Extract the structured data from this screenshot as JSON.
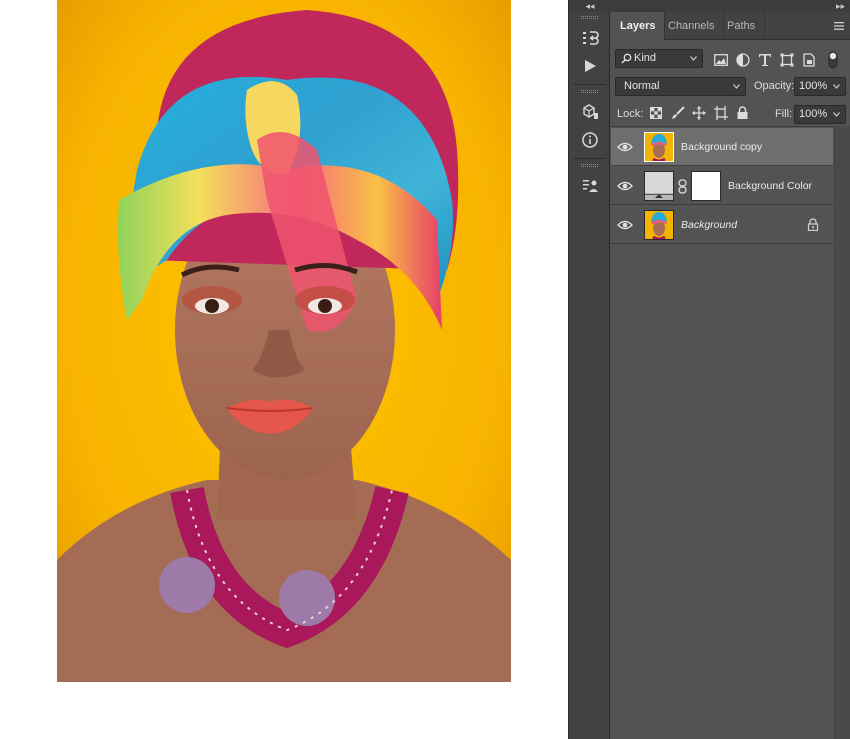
{
  "tabs": [
    {
      "label": "Layers",
      "active": true
    },
    {
      "label": "Channels",
      "active": false
    },
    {
      "label": "Paths",
      "active": false
    }
  ],
  "filter": {
    "kind_label": "Kind"
  },
  "blend": {
    "mode": "Normal",
    "opacity_label": "Opacity:",
    "opacity_value": "100%"
  },
  "lock": {
    "label": "Lock:",
    "fill_label": "Fill:",
    "fill_value": "100%"
  },
  "layers": [
    {
      "name": "Background copy",
      "selected": true,
      "visible": true,
      "italic": false
    },
    {
      "name": "Background Color",
      "selected": false,
      "visible": true,
      "italic": false
    },
    {
      "name": "Background",
      "selected": false,
      "visible": true,
      "italic": true,
      "locked": true
    }
  ],
  "colors": {
    "panel_bg": "#535353",
    "selected_row": "#6e6e6e",
    "photo_backdrop": "#f5b400",
    "fill_layer_swatch": "#d8d8d8"
  },
  "icons": [
    "search-icon",
    "image-filter-icon",
    "adjustment-filter-icon",
    "type-filter-icon",
    "shape-filter-icon",
    "smart-object-filter-icon",
    "filter-toggle-icon",
    "history-icon",
    "play-icon",
    "3d-icon",
    "info-icon",
    "properties-icon",
    "eye-icon",
    "chain-link-icon",
    "lock-icon"
  ]
}
